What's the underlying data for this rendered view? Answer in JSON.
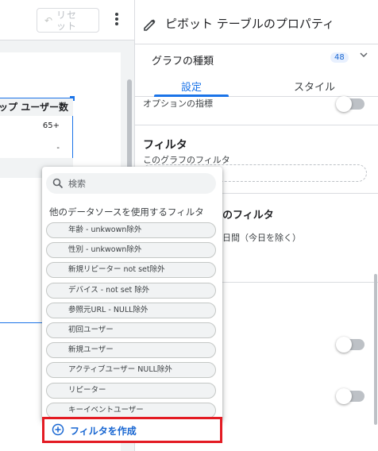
{
  "toolbar": {
    "reset_label": "リセット"
  },
  "canvas": {
    "column_header": "ップ ユーザー数",
    "rows": [
      "65+",
      "-"
    ]
  },
  "panel": {
    "title": "ピボット テーブルのプロパティ",
    "chart_type_label": "グラフの種類",
    "chart_badge": "48",
    "tabs": [
      "設定",
      "スタイル"
    ],
    "option_metric": "オプションの指標",
    "filter_title": "フィルタ",
    "filter_sub": "このグラフのフィルタ",
    "other_filter_title": "のフィルタ",
    "other_filter_sub": "日間（今日を除く）"
  },
  "popup": {
    "search_placeholder": "検索",
    "other_source_label": "他のデータソースを使用するフィルタ",
    "filters": [
      "年齢 - unkwown除外",
      "性別 - unkwown除外",
      "新規リピーター not set除外",
      "デバイス - not set 除外",
      "参照元URL - NULL除外",
      "初回ユーザー",
      "新規ユーザー",
      "アクティブユーザー NULL除外",
      "リピーター",
      "キーイベントユーザー"
    ],
    "create_label": "フィルタを作成"
  },
  "colors": {
    "accent": "#1a73e8",
    "highlight": "#e31b23"
  }
}
